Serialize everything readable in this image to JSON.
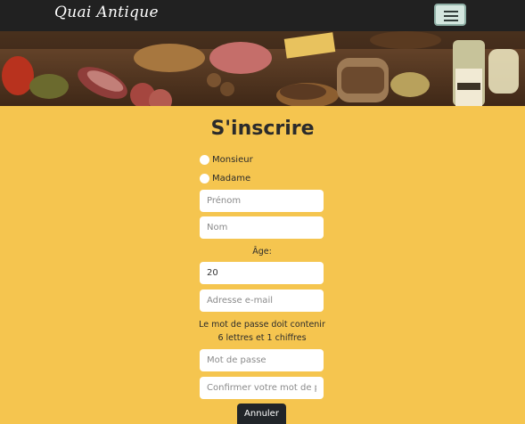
{
  "navbar": {
    "brand": "Quai Antique",
    "toggler_icon": "hamburger-menu-icon"
  },
  "hero": {
    "description_icon": "charcuterie-banner-image"
  },
  "form": {
    "title": "S'inscrire",
    "gender_options": [
      "Monsieur",
      "Madame"
    ],
    "first_name_placeholder": "Prénom",
    "last_name_placeholder": "Nom",
    "age_label": "Âge:",
    "age_value": "20",
    "email_placeholder": "Adresse e-mail",
    "password_rule_line1": "Le mot de passe doit contenir",
    "password_rule_line2": "6 lettres et 1 chiffres",
    "password_placeholder": "Mot de passe",
    "confirm_password_placeholder": "Confirmer votre mot de passe",
    "cancel_label": "Annuler"
  },
  "colors": {
    "background": "#f5c54f",
    "navbar": "#212121",
    "button": "#212529"
  }
}
